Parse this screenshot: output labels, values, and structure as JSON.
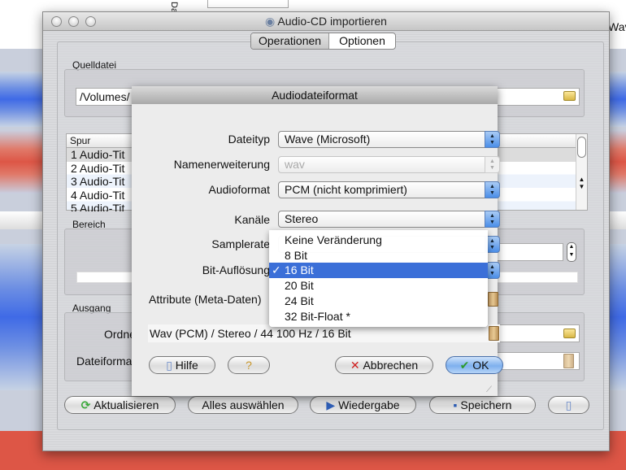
{
  "background": {
    "right_label": "Wave",
    "side_label": "Date"
  },
  "window": {
    "title": "Audio-CD importieren",
    "tabs": [
      {
        "label": "Operationen",
        "selected": true
      },
      {
        "label": "Optionen",
        "selected": false
      }
    ]
  },
  "source": {
    "label": "Quelldatei",
    "path": "/Volumes/"
  },
  "tracks": {
    "header": "Spur",
    "rows": [
      "1 Audio-Tit",
      "2 Audio-Tit",
      "3 Audio-Tit",
      "4 Audio-Tit",
      "5 Audio-Tit"
    ]
  },
  "range": {
    "label": "Bereich"
  },
  "output": {
    "label": "Ausgang",
    "folder_label": "Ordner",
    "format_label": "Dateiformat"
  },
  "toolbar": {
    "refresh": "Aktualisieren",
    "select_all": "Alles auswählen",
    "play": "Wiedergabe",
    "save": "Speichern"
  },
  "sheet": {
    "title": "Audiodateiformat",
    "fields": {
      "filetype": {
        "label": "Dateityp",
        "value": "Wave (Microsoft)"
      },
      "extension": {
        "label": "Namenerweiterung",
        "value": "wav"
      },
      "audioformat": {
        "label": "Audioformat",
        "value": "PCM (nicht komprimiert)"
      },
      "channels": {
        "label": "Kanäle",
        "value": "Stereo"
      },
      "samplerate": {
        "label": "Samplerate"
      },
      "bitdepth": {
        "label": "Bit-Auflösung"
      },
      "attributes": {
        "label": "Attribute (Meta-Daten)"
      }
    },
    "summary": "Wav (PCM) / Stereo / 44 100 Hz / 16 Bit",
    "buttons": {
      "help": "Hilfe",
      "cancel": "Abbrechen",
      "ok": "OK"
    },
    "menu": {
      "items": [
        "Keine Veränderung",
        "8 Bit",
        "16 Bit",
        "20 Bit",
        "24 Bit",
        "32 Bit-Float *"
      ],
      "selected_index": 2,
      "check": "✓"
    }
  },
  "colors": {
    "accent": "#3b6fd8",
    "wave_blue": "#3f6ae6",
    "wave_red": "#dd5646"
  }
}
